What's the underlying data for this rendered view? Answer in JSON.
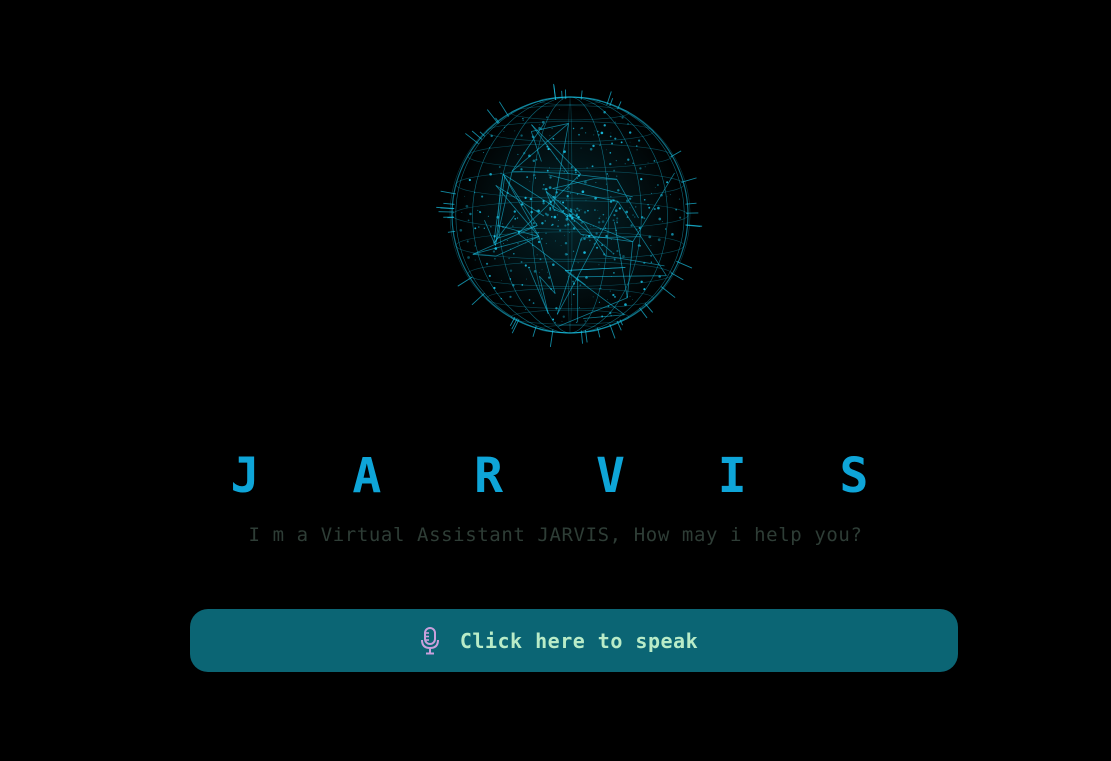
{
  "app": {
    "title": "J A R V I S",
    "subtitle": "I m a Virtual Assistant JARVIS, How may i help you?"
  },
  "speak_button": {
    "label": "Click here to speak",
    "icon": "microphone-icon"
  },
  "hero": {
    "icon": "wireframe-globe-icon"
  },
  "colors": {
    "background": "#000000",
    "title": "#0ea5d8",
    "subtitle": "#2e3d36",
    "button_bg": "#0b6574",
    "button_text": "#b9ecc8",
    "mic": "#c9a0dc",
    "globe": "#19c3e6"
  }
}
